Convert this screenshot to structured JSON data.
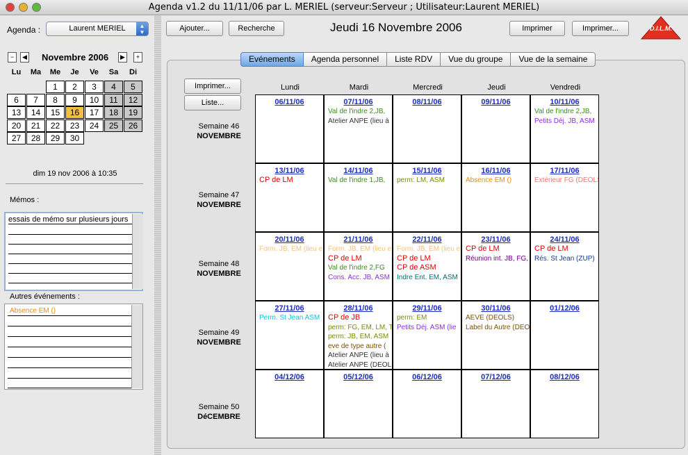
{
  "window": {
    "title": "Agenda v1.2 du 11/11/06 par L. MERIEL (serveur:Serveur ; Utilisateur:Laurent MERIEL)"
  },
  "left": {
    "agenda_label": "Agenda :",
    "agenda_value": "Laurent MERIEL",
    "month_label": "Novembre 2006",
    "nav": {
      "minus": "−",
      "prev": "◀",
      "next": "▶",
      "plus": "+"
    },
    "weekdays": [
      "Lu",
      "Ma",
      "Me",
      "Je",
      "Ve",
      "Sa",
      "Di"
    ],
    "today_day": "16",
    "datetime": "dim 19 nov 2006 à 10:35",
    "memos_label": "Mémos :",
    "memo_text": "essais de mémo sur plusieurs jours",
    "other_events_label": "Autres événements :",
    "other_events": [
      "Absence EM ()"
    ]
  },
  "toolbar": {
    "add_label": "Ajouter...",
    "search_label": "Recherche",
    "date_title": "Jeudi 16 Novembre 2006",
    "print_label": "Imprimer",
    "print_more_label": "Imprimer...",
    "logo_text": "D.I.L.M."
  },
  "tabs": [
    "Evénements",
    "Agenda personnel",
    "Liste RDV",
    "Vue du groupe",
    "Vue de la semaine"
  ],
  "active_tab": "Evénements",
  "side_buttons": {
    "print": "Imprimer...",
    "list": "Liste..."
  },
  "weekday_headers": [
    "Lundi",
    "Mardi",
    "Mercredi",
    "Jeudi",
    "Vendredi"
  ],
  "weeks": [
    {
      "label": "Semaine 46",
      "month": "NOVEMBRE",
      "days": [
        {
          "date": "06/11/06",
          "events": []
        },
        {
          "date": "07/11/06",
          "events": [
            {
              "text": "Val de l'indre 2,JB,",
              "color": "#3a8a1e"
            },
            {
              "text": "Atelier ANPE  (lieu à",
              "color": "#333333"
            }
          ]
        },
        {
          "date": "08/11/06",
          "events": []
        },
        {
          "date": "09/11/06",
          "events": []
        },
        {
          "date": "10/11/06",
          "events": [
            {
              "text": "Val de l'indre 2,JB,",
              "color": "#3a8a1e"
            },
            {
              "text": "Petits Déj. JB, ASM",
              "color": "#8a2be2"
            }
          ]
        }
      ]
    },
    {
      "label": "Semaine 47",
      "month": "NOVEMBRE",
      "days": [
        {
          "date": "13/11/06",
          "events": [
            {
              "text": "CP de LM",
              "color": "#e00000",
              "big": true
            }
          ]
        },
        {
          "date": "14/11/06",
          "events": [
            {
              "text": "Val de l'indre 1,JB,",
              "color": "#3a8a1e"
            }
          ]
        },
        {
          "date": "15/11/06",
          "events": [
            {
              "text": "perm: LM, ASM",
              "color": "#7a8a00"
            }
          ]
        },
        {
          "date": "16/11/06",
          "events": [
            {
              "text": "Absence EM ()",
              "color": "#f08a00"
            }
          ]
        },
        {
          "date": "17/11/06",
          "events": [
            {
              "text": "Extérieur FG (DEOLS",
              "color": "#ff7070"
            }
          ]
        }
      ]
    },
    {
      "label": "Semaine 48",
      "month": "NOVEMBRE",
      "days": [
        {
          "date": "20/11/06",
          "events": [
            {
              "text": "Form. JB, EM (lieu e",
              "color": "#f5c27a"
            }
          ]
        },
        {
          "date": "21/11/06",
          "events": [
            {
              "text": "Form. JB, EM (lieu e",
              "color": "#f5c27a"
            },
            {
              "text": "CP de LM",
              "color": "#e00000",
              "big": true
            },
            {
              "text": "Val de l'indre 2,FG",
              "color": "#3a8a1e"
            },
            {
              "text": "Cons. Acc. JB, ASM",
              "color": "#8a2be2"
            }
          ]
        },
        {
          "date": "22/11/06",
          "events": [
            {
              "text": "Form. JB, EM (lieu e",
              "color": "#f5c27a"
            },
            {
              "text": "CP de LM",
              "color": "#e00000",
              "big": true
            },
            {
              "text": "CP de ASM",
              "color": "#e00000",
              "big": true
            },
            {
              "text": "Indre Ent. EM, ASM",
              "color": "#007070"
            }
          ]
        },
        {
          "date": "23/11/06",
          "events": [
            {
              "text": "CP de LM",
              "color": "#e00000",
              "big": true
            },
            {
              "text": "Réunion int. JB, FG,",
              "color": "#6a0080"
            }
          ]
        },
        {
          "date": "24/11/06",
          "events": [
            {
              "text": "CP de LM",
              "color": "#e00000",
              "big": true
            },
            {
              "text": "Rés. St Jean  (ZUP)",
              "color": "#1a3a80"
            }
          ]
        }
      ]
    },
    {
      "label": "Semaine 49",
      "month": "NOVEMBRE",
      "days": [
        {
          "date": "27/11/06",
          "events": [
            {
              "text": "Perm. St Jean ASM",
              "color": "#00c8e0"
            }
          ]
        },
        {
          "date": "28/11/06",
          "events": [
            {
              "text": "CP de JB",
              "color": "#e00000",
              "big": true
            },
            {
              "text": "perm: FG, EM, LM, T",
              "color": "#7a8a00"
            },
            {
              "text": "perm: JB, EM, ASM",
              "color": "#7a8a00"
            },
            {
              "text": "eve de type autre (",
              "color": "#7a5200"
            },
            {
              "text": "Atelier ANPE  (lieu à",
              "color": "#333333"
            },
            {
              "text": "Atelier ANPE  (DEOL",
              "color": "#333333"
            }
          ]
        },
        {
          "date": "29/11/06",
          "events": [
            {
              "text": "perm: EM",
              "color": "#7a8a00"
            },
            {
              "text": "Petits Déj. ASM (lie",
              "color": "#8a2be2"
            }
          ]
        },
        {
          "date": "30/11/06",
          "events": [
            {
              "text": "AEVE (DEOLS)",
              "color": "#7a5200"
            },
            {
              "text": "Label du Autre (DEO",
              "color": "#7a5200"
            }
          ]
        },
        {
          "date": "01/12/06",
          "events": []
        }
      ]
    },
    {
      "label": "Semaine 50",
      "month": "DéCEMBRE",
      "days": [
        {
          "date": "04/12/06",
          "events": []
        },
        {
          "date": "05/12/06",
          "events": []
        },
        {
          "date": "06/12/06",
          "events": []
        },
        {
          "date": "07/12/06",
          "events": []
        },
        {
          "date": "08/12/06",
          "events": []
        }
      ]
    }
  ]
}
